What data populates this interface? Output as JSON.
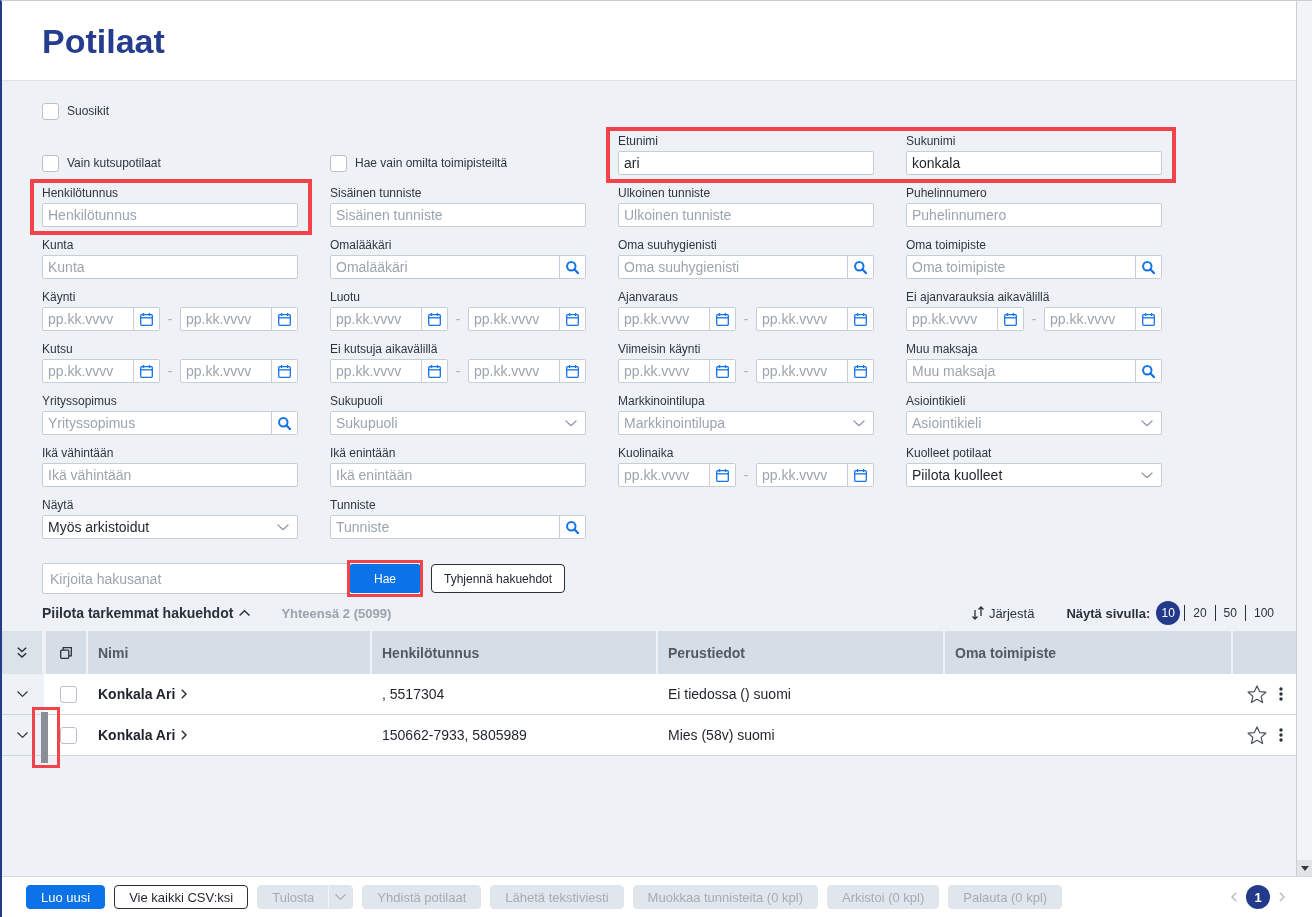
{
  "header": {
    "title": "Potilaat"
  },
  "filters": {
    "rows": [
      [
        {
          "kind": "checkbox",
          "label": "Suosikit",
          "checked": false
        }
      ],
      [
        {
          "kind": "checkbox",
          "label": "Vain kutsupotilaat",
          "checked": false
        },
        {
          "kind": "checkbox",
          "label": "Hae vain omilta toimipisteiltä",
          "checked": false
        },
        {
          "kind": "highlight",
          "fields": [
            {
              "kind": "text",
              "label": "Etunimi",
              "value": "ari"
            },
            {
              "kind": "text",
              "label": "Sukunimi",
              "value": "konkala"
            }
          ]
        }
      ],
      [
        {
          "kind": "highlight",
          "fields": [
            {
              "kind": "text",
              "label": "Henkilötunnus",
              "placeholder": "Henkilötunnus"
            }
          ]
        },
        {
          "kind": "text",
          "label": "Sisäinen tunniste",
          "placeholder": "Sisäinen tunniste"
        },
        {
          "kind": "text",
          "label": "Ulkoinen tunniste",
          "placeholder": "Ulkoinen tunniste"
        },
        {
          "kind": "text",
          "label": "Puhelinnumero",
          "placeholder": "Puhelinnumero"
        }
      ],
      [
        {
          "kind": "text",
          "label": "Kunta",
          "placeholder": "Kunta"
        },
        {
          "kind": "search",
          "label": "Omalääkäri",
          "placeholder": "Omalääkäri"
        },
        {
          "kind": "search",
          "label": "Oma suuhygienisti",
          "placeholder": "Oma suuhygienisti"
        },
        {
          "kind": "search",
          "label": "Oma toimipiste",
          "placeholder": "Oma toimipiste"
        }
      ],
      [
        {
          "kind": "date_range",
          "label": "Käynti",
          "from": {
            "placeholder": "pp.kk.vvvv"
          },
          "separator": "-",
          "to": {
            "placeholder": "pp.kk.vvvv"
          }
        },
        {
          "kind": "date_range",
          "label": "Luotu",
          "from": {
            "placeholder": "pp.kk.vvvv"
          },
          "separator": "-",
          "to": {
            "placeholder": "pp.kk.vvvv"
          }
        },
        {
          "kind": "date_range",
          "label": "Ajanvaraus",
          "from": {
            "placeholder": "pp.kk.vvvv"
          },
          "separator": "-",
          "to": {
            "placeholder": "pp.kk.vvvv"
          }
        },
        {
          "kind": "date_range",
          "label": "Ei ajanvarauksia aikavälillä",
          "from": {
            "placeholder": "pp.kk.vvvv"
          },
          "separator": "-",
          "to": {
            "placeholder": "pp.kk.vvvv"
          }
        }
      ],
      [
        {
          "kind": "date_range",
          "label": "Kutsu",
          "from": {
            "placeholder": "pp.kk.vvvv"
          },
          "separator": "-",
          "to": {
            "placeholder": "pp.kk.vvvv"
          }
        },
        {
          "kind": "date_range",
          "label": "Ei kutsuja aikavälillä",
          "from": {
            "placeholder": "pp.kk.vvvv"
          },
          "separator": "-",
          "to": {
            "placeholder": "pp.kk.vvvv"
          }
        },
        {
          "kind": "date_range",
          "label": "Viimeisin käynti",
          "from": {
            "placeholder": "pp.kk.vvvv"
          },
          "separator": "-",
          "to": {
            "placeholder": "pp.kk.vvvv"
          }
        },
        {
          "kind": "search",
          "label": "Muu maksaja",
          "placeholder": "Muu maksaja"
        }
      ],
      [
        {
          "kind": "search",
          "label": "Yrityssopimus",
          "placeholder": "Yrityssopimus"
        },
        {
          "kind": "select",
          "label": "Sukupuoli",
          "placeholder": "Sukupuoli"
        },
        {
          "kind": "select",
          "label": "Markkinointilupa",
          "placeholder": "Markkinointilupa"
        },
        {
          "kind": "select",
          "label": "Asiointikieli",
          "placeholder": "Asiointikieli"
        }
      ],
      [
        {
          "kind": "text",
          "label": "Ikä vähintään",
          "placeholder": "Ikä vähintään"
        },
        {
          "kind": "text",
          "label": "Ikä enintään",
          "placeholder": "Ikä enintään"
        },
        {
          "kind": "date_range",
          "label": "Kuolinaika",
          "from": {
            "placeholder": "pp.kk.vvvv"
          },
          "separator": "-",
          "to": {
            "placeholder": "pp.kk.vvvv"
          }
        },
        {
          "kind": "select",
          "label": "Kuolleet potilaat",
          "value": "Piilota kuolleet"
        }
      ],
      [
        {
          "kind": "select",
          "label": "Näytä",
          "value": "Myös arkistoidut"
        },
        {
          "kind": "search",
          "label": "Tunniste",
          "placeholder": "Tunniste"
        }
      ]
    ]
  },
  "search_bar": {
    "placeholder": "Kirjoita hakusanat",
    "submit": {
      "label": "Hae",
      "highlighted": true
    },
    "clear": {
      "label": "Tyhjennä hakuehdot"
    }
  },
  "list_bar": {
    "toggle": {
      "label": "Piilota tarkemmat hakuehdot",
      "expanded": true
    },
    "total": "Yhteensä 2 (5099)",
    "sort": {
      "label": "Järjestä"
    },
    "page_size": {
      "label": "Näytä sivulla:",
      "options": [
        {
          "label": "10",
          "selected": true
        },
        {
          "label": "20",
          "selected": false
        },
        {
          "label": "50",
          "selected": false
        },
        {
          "label": "100",
          "selected": false
        }
      ]
    }
  },
  "table": {
    "columns": [
      "Nimi",
      "Henkilötunnus",
      "Perustiedot",
      "Oma toimipiste"
    ],
    "rows": [
      {
        "expanded": false,
        "checked": false,
        "marked": false,
        "favorite": false,
        "cells": [
          "Konkala Ari",
          ", 5517304",
          "Ei tiedossa () suomi"
        ]
      },
      {
        "expanded": false,
        "checked": false,
        "marked": true,
        "favorite": false,
        "cells": [
          "Konkala Ari",
          "150662-7933, 5805989",
          "Mies (58v) suomi"
        ]
      }
    ]
  },
  "bottom_bar": {
    "buttons": [
      {
        "label": "Luo uusi",
        "kind": "primary",
        "disabled": false
      },
      {
        "label": "Vie kaikki CSV:ksi",
        "kind": "outline",
        "disabled": false
      },
      {
        "label": "Tulosta",
        "kind": "dropdown",
        "disabled": true
      },
      {
        "label": "Yhdistä potilaat",
        "kind": "plain",
        "disabled": true
      },
      {
        "label": "Lähetä tekstiviesti",
        "kind": "plain",
        "disabled": true
      },
      {
        "label": "Muokkaa tunnisteita (0 kpl)",
        "kind": "plain",
        "disabled": true
      },
      {
        "label": "Arkistoi (0 kpl)",
        "kind": "plain",
        "disabled": true
      },
      {
        "label": "Palauta (0 kpl)",
        "kind": "plain",
        "disabled": true
      }
    ],
    "pagination": {
      "previous": {
        "disabled": true
      },
      "pages": [
        {
          "label": "1",
          "selected": true
        }
      ],
      "next": {
        "disabled": true
      }
    }
  }
}
